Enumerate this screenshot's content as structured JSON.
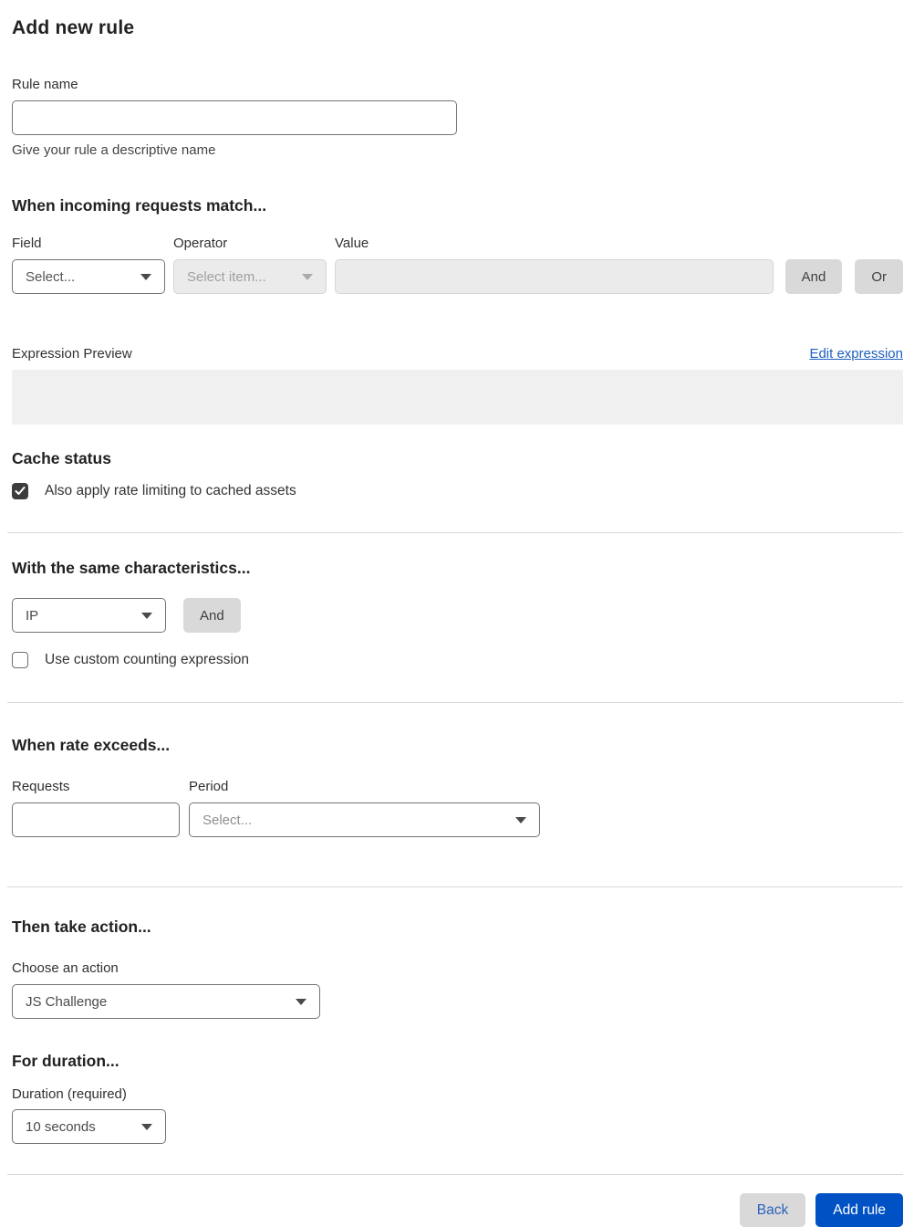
{
  "page": {
    "title": "Add new rule"
  },
  "rule_name": {
    "label": "Rule name",
    "value": "",
    "helper": "Give your rule a descriptive name"
  },
  "match": {
    "heading": "When incoming requests match...",
    "field": {
      "label": "Field",
      "selected": "Select..."
    },
    "operator": {
      "label": "Operator",
      "selected": "Select item..."
    },
    "value": {
      "label": "Value",
      "value": ""
    },
    "and_label": "And",
    "or_label": "Or"
  },
  "expression": {
    "label": "Expression Preview",
    "edit_link": "Edit expression",
    "preview_text": ""
  },
  "cache": {
    "heading": "Cache status",
    "checkbox_label": "Also apply rate limiting to cached assets",
    "checked": true
  },
  "characteristics": {
    "heading": "With the same characteristics...",
    "selected": "IP",
    "and_label": "And",
    "checkbox_label": "Use custom counting expression",
    "checked": false
  },
  "rate": {
    "heading": "When rate exceeds...",
    "requests": {
      "label": "Requests",
      "value": ""
    },
    "period": {
      "label": "Period",
      "placeholder": "Select..."
    }
  },
  "action": {
    "heading": "Then take action...",
    "label": "Choose an action",
    "selected": "JS Challenge"
  },
  "duration": {
    "heading": "For duration...",
    "label": "Duration (required)",
    "selected": "10 seconds"
  },
  "footer": {
    "back_label": "Back",
    "submit_label": "Add rule"
  },
  "colors": {
    "accent": "#0051c3",
    "link": "#1d5fbf",
    "divider": "#d9d9d9",
    "disabled_bg": "#ebebeb",
    "checkbox_checked": "#3d3d3d"
  }
}
